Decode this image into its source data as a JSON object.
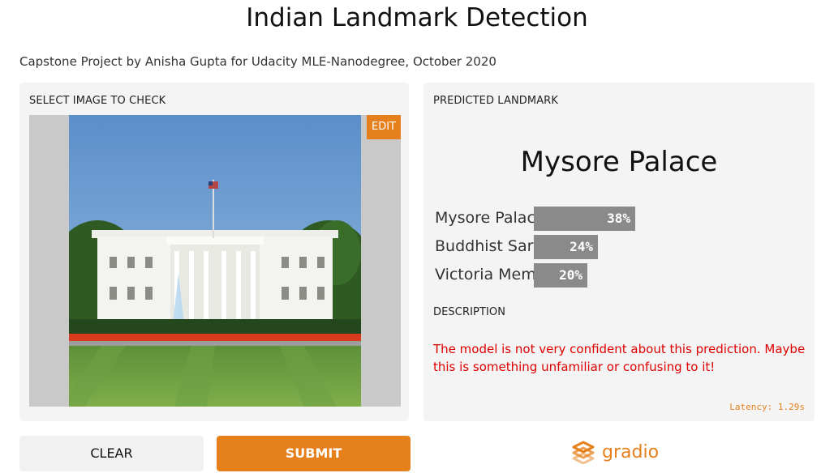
{
  "header": {
    "title": "Indian Landmark Detection",
    "subtitle": "Capstone Project by Anisha Gupta for Udacity MLE-Nanodegree, October 2020"
  },
  "input_panel": {
    "label": "SELECT IMAGE TO CHECK",
    "edit_label": "EDIT"
  },
  "output_panel": {
    "label": "PREDICTED LANDMARK",
    "predicted": "Mysore Palace",
    "confidences": [
      {
        "label": "Mysore Palace",
        "percent_text": "38%",
        "value": 0.38
      },
      {
        "label": "Buddhist Sarnath",
        "percent_text": "24%",
        "value": 0.24
      },
      {
        "label": "Victoria Memorial",
        "percent_text": "20%",
        "value": 0.2
      }
    ],
    "description_label": "DESCRIPTION",
    "description": "The model is not very confident about this prediction. Maybe this is something unfamiliar or confusing to it!",
    "latency": "Latency: 1.29s"
  },
  "actions": {
    "clear_label": "CLEAR",
    "submit_label": "SUBMIT"
  },
  "branding": {
    "name": "gradio",
    "icon": "gradio-logo-icon",
    "accent_color": "#e6801d"
  },
  "colors": {
    "description": "#e00000",
    "bar": "#8a8a8a",
    "panel": "#f4f4f4"
  }
}
